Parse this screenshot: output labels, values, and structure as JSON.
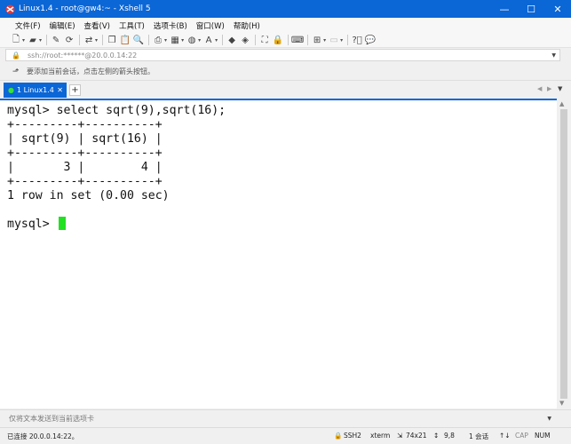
{
  "window": {
    "title": "Linux1.4 - root@gw4:~ - Xshell 5",
    "minimize_glyph": "—",
    "maximize_glyph": "☐",
    "close_glyph": "✕"
  },
  "menu": [
    "文件(F)",
    "编辑(E)",
    "查看(V)",
    "工具(T)",
    "选项卡(B)",
    "窗口(W)",
    "帮助(H)"
  ],
  "toolbar_icons": [
    "new-session-icon",
    "open-folder-icon",
    "properties-icon",
    "reconnect-icon",
    "disconnect-icon",
    "transfer-icon",
    "copy-icon",
    "paste-icon",
    "find-icon",
    "print-icon",
    "color-scheme-icon",
    "globe-icon",
    "font-icon",
    "xftp-icon",
    "tunnel-icon",
    "fullscreen-icon",
    "lock-icon",
    "keyboard-icon",
    "compose-icon",
    "script-icon",
    "help-icon",
    "chat-icon"
  ],
  "address": {
    "value": "ssh://root:******@20.0.0.14:22"
  },
  "hint": {
    "text": "要添加当前会话，点击左侧的箭头按钮。"
  },
  "tabs": [
    {
      "label": "1 Linux1.4",
      "active": true,
      "status_color": "#38e038"
    }
  ],
  "tab_controls": {
    "new_tab": "+",
    "prev": "◀",
    "next": "▶",
    "menu": "▼"
  },
  "terminal": {
    "lines": [
      "mysql> select sqrt(9),sqrt(16);",
      "+---------+----------+",
      "| sqrt(9) | sqrt(16) |",
      "+---------+----------+",
      "|       3 |        4 |",
      "+---------+----------+",
      "1 row in set (0.00 sec)",
      "",
      "mysql> "
    ],
    "cursor_color": "#22e022"
  },
  "compose_bar": {
    "placeholder": "仅将文本发送到当前选项卡"
  },
  "status": {
    "connection": "已连接 20.0.0.14:22。",
    "protocol": "SSH2",
    "terminal_type": "xterm",
    "size": "74x21",
    "cursor_pos": "9,8",
    "sessions": "1 会话",
    "caps": "CAP",
    "num": "NUM"
  },
  "colors": {
    "accent": "#0b66d6",
    "terminal_bg": "#ffffff",
    "terminal_fg": "#111111"
  }
}
